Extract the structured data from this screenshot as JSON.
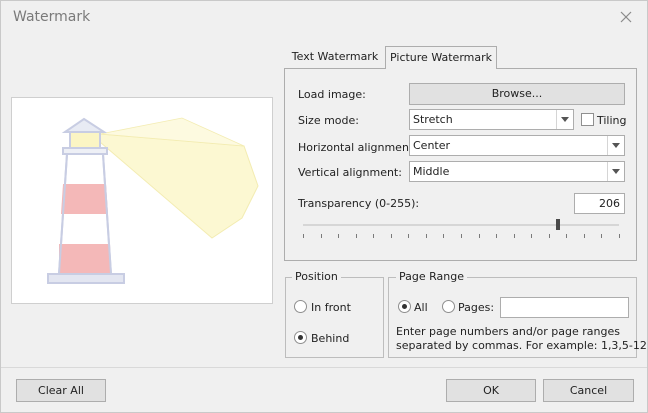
{
  "window": {
    "title": "Watermark"
  },
  "tabs": [
    {
      "label": "Text Watermark",
      "active": false
    },
    {
      "label": "Picture Watermark",
      "active": true
    }
  ],
  "picture": {
    "load_image_label": "Load image:",
    "browse_label": "Browse...",
    "size_mode_label": "Size mode:",
    "size_mode_value": "Stretch",
    "tiling_label": "Tiling",
    "tiling_checked": false,
    "h_align_label": "Horizontal alignment:",
    "h_align_value": "Center",
    "v_align_label": "Vertical alignment:",
    "v_align_value": "Middle",
    "transparency_label": "Transparency (0-255):",
    "transparency_value": "206",
    "transparency_level": 206,
    "transparency_max": 255
  },
  "position": {
    "title": "Position",
    "in_front_label": "In front",
    "behind_label": "Behind",
    "selected": "behind"
  },
  "page_range": {
    "title": "Page Range",
    "all_label": "All",
    "pages_label": "Pages:",
    "pages_value": "",
    "selected": "all",
    "help_line1": "Enter page numbers and/or page ranges",
    "help_line2": "separated by commas. For example: 1,3,5-12"
  },
  "buttons": {
    "clear_all": "Clear All",
    "ok": "OK",
    "cancel": "Cancel"
  },
  "colors": {
    "accent_red": "#f4b8b8",
    "beam_yellow": "#fbf7c8",
    "tower_outline": "#c8cde3"
  }
}
